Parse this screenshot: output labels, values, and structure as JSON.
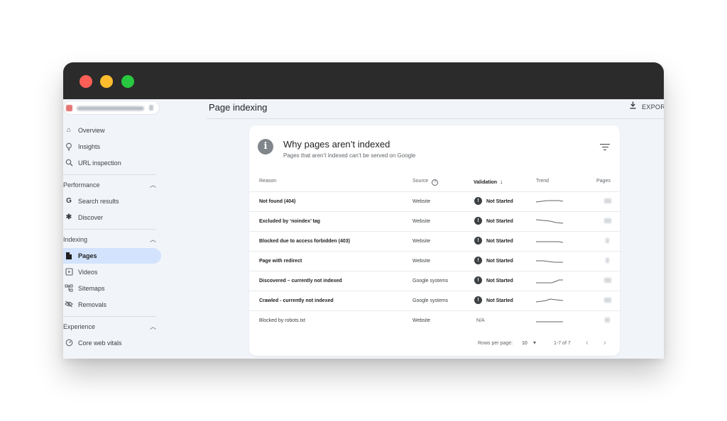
{
  "window": {
    "traffic_lights": [
      "close",
      "minimize",
      "maximize"
    ],
    "colors": {
      "close": "#ff5f57",
      "minimize": "#febc2e",
      "maximize": "#28c840"
    }
  },
  "sidebar": {
    "top_items": [
      {
        "label": "Overview",
        "icon": "home-icon"
      },
      {
        "label": "Insights",
        "icon": "lightbulb-icon"
      },
      {
        "label": "URL inspection",
        "icon": "search-icon"
      }
    ],
    "performance": {
      "title": "Performance",
      "items": [
        {
          "label": "Search results",
          "icon": "google-g-icon"
        },
        {
          "label": "Discover",
          "icon": "asterisk-icon"
        }
      ]
    },
    "indexing": {
      "title": "Indexing",
      "items": [
        {
          "label": "Pages",
          "icon": "pages-icon",
          "active": true
        },
        {
          "label": "Videos",
          "icon": "video-icon"
        },
        {
          "label": "Sitemaps",
          "icon": "sitemap-icon"
        },
        {
          "label": "Removals",
          "icon": "eye-off-icon"
        }
      ]
    },
    "experience": {
      "title": "Experience",
      "items": [
        {
          "label": "Core web vitals",
          "icon": "gauge-icon"
        }
      ]
    }
  },
  "header": {
    "title": "Page indexing",
    "export_label": "EXPORT"
  },
  "card": {
    "title": "Why pages aren’t indexed",
    "subtitle": "Pages that aren’t indexed can’t be served on Google",
    "columns": {
      "reason": "Reason",
      "source": "Source",
      "validation": "Validation",
      "trend": "Trend",
      "pages": "Pages"
    },
    "rows": [
      {
        "reason": "Not found (404)",
        "source": "Website",
        "validation": "Not Started"
      },
      {
        "reason": "Excluded by ‘noindex’ tag",
        "source": "Website",
        "validation": "Not Started"
      },
      {
        "reason": "Blocked due to access forbidden (403)",
        "source": "Website",
        "validation": "Not Started"
      },
      {
        "reason": "Page with redirect",
        "source": "Website",
        "validation": "Not Started"
      },
      {
        "reason": "Discovered – currently not indexed",
        "source": "Google systems",
        "validation": "Not Started"
      },
      {
        "reason": "Crawled - currently not indexed",
        "source": "Google systems",
        "validation": "Not Started"
      },
      {
        "reason": "Blocked by robots.txt",
        "source": "Website",
        "validation": "N/A"
      }
    ],
    "footer": {
      "rows_per_page_label": "Rows per page:",
      "rows_per_page_value": "10",
      "range": "1-7 of 7"
    }
  },
  "colors": {
    "active_nav": "#d3e3fd",
    "app_background": "#f1f4f9",
    "badge": "#3c4043"
  }
}
